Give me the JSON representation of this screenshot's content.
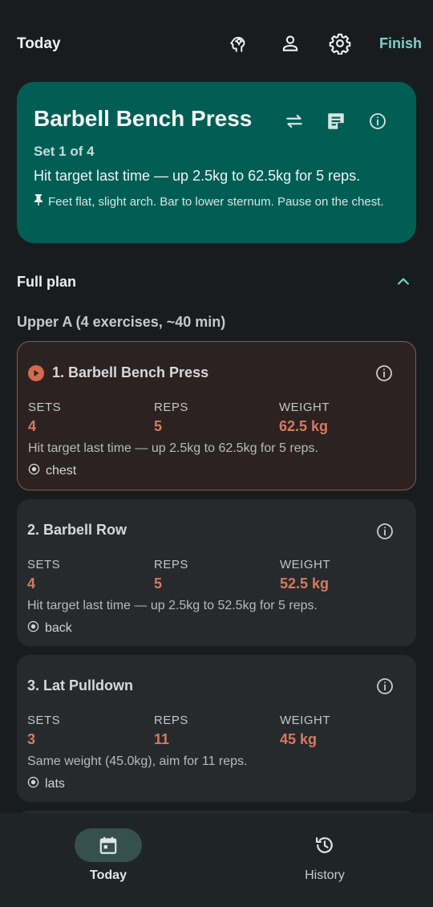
{
  "header": {
    "title": "Today",
    "icons": [
      "brain-icon",
      "person-icon",
      "gear-icon"
    ],
    "finish_label": "Finish"
  },
  "current": {
    "exercise": "Barbell Bench Press",
    "set_label": "Set 1 of 4",
    "hint": "Hit target last time — up 2.5kg to 62.5kg for 5 reps.",
    "note": "Feet flat, slight arch. Bar to lower sternum. Pause on the chest.",
    "icons": [
      "swap-icon",
      "notes-icon",
      "info-icon"
    ]
  },
  "plan": {
    "section_title": "Full plan",
    "workout_title": "Upper A (4 exercises, ~40 min)",
    "col_labels": {
      "sets": "SETS",
      "reps": "REPS",
      "weight": "WEIGHT"
    },
    "exercises": [
      {
        "title": "1. Barbell Bench Press",
        "sets": "4",
        "reps": "5",
        "weight": "62.5 kg",
        "hint": "Hit target last time — up 2.5kg to 62.5kg for 5 reps.",
        "muscle": "chest",
        "active": true
      },
      {
        "title": "2. Barbell Row",
        "sets": "4",
        "reps": "5",
        "weight": "52.5 kg",
        "hint": "Hit target last time — up 2.5kg to 52.5kg for 5 reps.",
        "muscle": "back",
        "active": false
      },
      {
        "title": "3. Lat Pulldown",
        "sets": "3",
        "reps": "11",
        "weight": "45 kg",
        "hint": "Same weight (45.0kg), aim for 11 reps.",
        "muscle": "lats",
        "active": false
      }
    ]
  },
  "nav": {
    "items": [
      {
        "label": "Today",
        "icon": "calendar-icon",
        "active": true
      },
      {
        "label": "History",
        "icon": "history-icon",
        "active": false
      }
    ]
  },
  "colors": {
    "accent": "#7ad3c6",
    "hero_bg": "#005e55",
    "value_orange": "#d77a5e",
    "active_card_border": "#8a5a4c"
  }
}
